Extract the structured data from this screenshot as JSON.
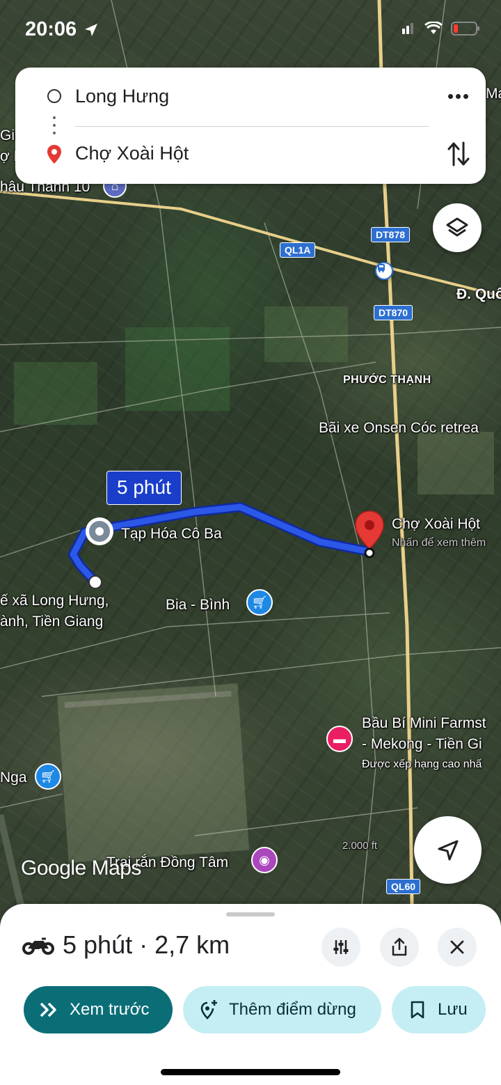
{
  "status_bar": {
    "time": "20:06"
  },
  "directions": {
    "origin": "Long Hưng",
    "destination": "Chợ Xoài Hột"
  },
  "map": {
    "route_badge": "5 phút",
    "roads": {
      "ql1a": "QL1A",
      "dt878": "DT878",
      "dt870": "DT870",
      "ql60": "QL60"
    },
    "labels": {
      "chau_thanh": "hâu Thành 10",
      "duong_quoc": "Đ. Quố",
      "phuoc_thanh": "PHƯỚC THẠNH",
      "bai_xe": "Bãi xe Onsen Cóc retrea",
      "cho_xoai_hot": "Chợ Xoài Hột",
      "nhan_de_xem": "Nhấn để xem thêm",
      "tap_hoa": "Tạp Hóa Cô Ba",
      "uy_ban_1": "ế xã Long Hưng,",
      "uy_ban_2": "ành, Tiền Giang",
      "bia_binh": "Bia - Bình",
      "bau_bi_1": "Bầu Bí Mini Farmst",
      "bau_bi_2": "- Mekong - Tiền Gi",
      "bau_bi_3": "Được xếp hạng cao nhấ",
      "nga": "Nga",
      "trai_ran": "Trại rắn Đồng Tâm",
      "left_gi": "Gi",
      "left_h": "ợ H",
      "top_right_ma": "Ma",
      "scale": "2.000 ft"
    },
    "logo": "Google Maps"
  },
  "trip": {
    "mode_icon": "motorcycle-icon",
    "summary": "5 phút · 2,7 km"
  },
  "actions": {
    "preview": "Xem trước",
    "add_stop": "Thêm điểm dừng",
    "save": "Lưu"
  },
  "colors": {
    "route": "#1a3ec9",
    "primary_button": "#0b6e77",
    "secondary_button": "#c4eef4",
    "destination_pin": "#e53935"
  }
}
